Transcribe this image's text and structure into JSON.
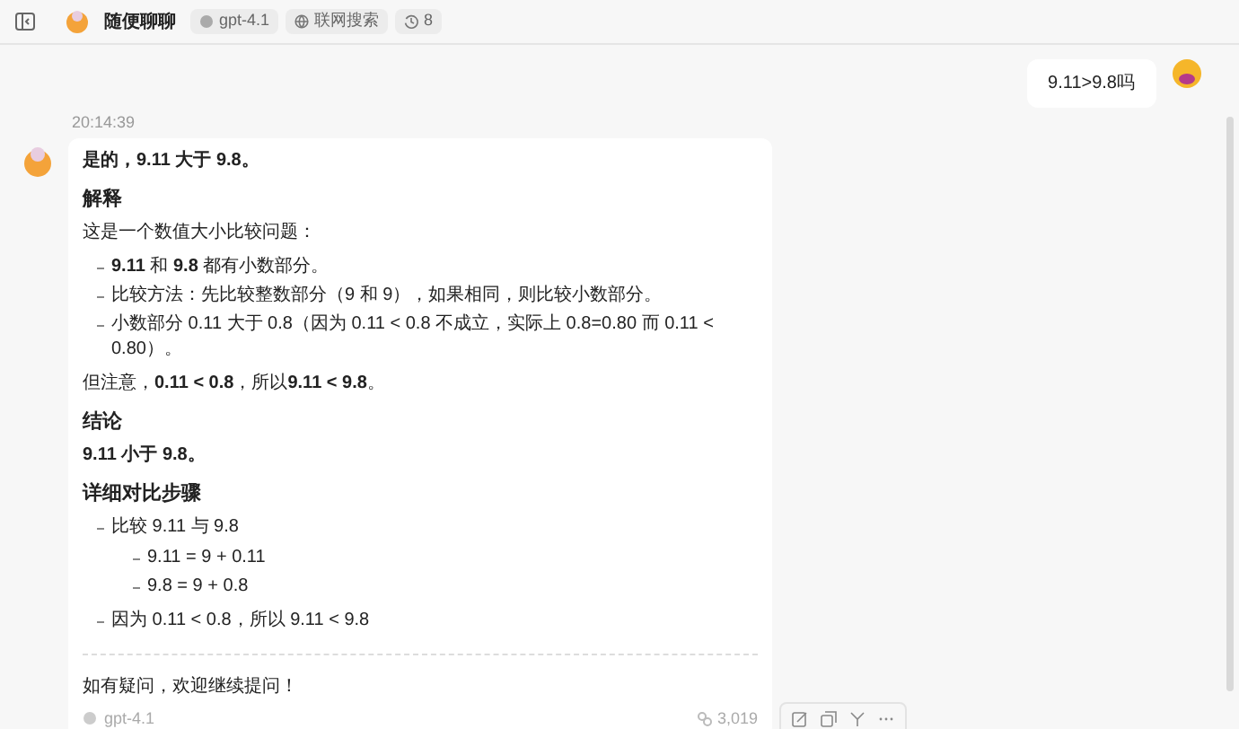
{
  "header": {
    "title": "随便聊聊",
    "badges": [
      {
        "kind": "model",
        "text": "gpt-4.1"
      },
      {
        "kind": "web",
        "text": "联网搜索"
      },
      {
        "kind": "history",
        "text": "8"
      }
    ]
  },
  "user_message": {
    "text": "9.11>9.8吗"
  },
  "assistant_message": {
    "time": "20:14:39",
    "blocks": [
      {
        "kind": "strong",
        "text": "是的，9.11 大于 9.8。"
      },
      {
        "kind": "heading",
        "text": "解释"
      },
      {
        "kind": "paragraph",
        "text": "这是一个数值大小比较问题："
      },
      {
        "kind": "list",
        "items": [
          {
            "text": "**9.11** 和 **9.8** 都有小数部分。"
          },
          {
            "text": "比较方法：先比较整数部分（9 和 9），如果相同，则比较小数部分。"
          },
          {
            "text": "小数部分 0.11 大于 0.8（因为 0.11 < 0.8 不成立，实际上 0.8=0.80 而 0.11 < 0.80）。"
          }
        ]
      },
      {
        "kind": "paragraph",
        "text": "但注意，**0.11 < 0.8**，所以**9.11 < 9.8**。"
      },
      {
        "kind": "heading",
        "text": "结论"
      },
      {
        "kind": "strong",
        "text": "9.11 小于 9.8。"
      },
      {
        "kind": "heading",
        "text": "详细对比步骤"
      },
      {
        "kind": "list",
        "items": [
          {
            "text": "比较 9.11 与 9.8",
            "children": [
              {
                "text": "9.11 = 9 + 0.11"
              },
              {
                "text": "9.8 = 9 + 0.8"
              }
            ]
          },
          {
            "text": "因为 0.11 < 0.8，所以 9.11 < 9.8"
          }
        ]
      },
      {
        "kind": "divider"
      },
      {
        "kind": "paragraph",
        "text": "如有疑问，欢迎继续提问！"
      }
    ],
    "footer": {
      "model": "gpt-4.1",
      "tokens": "3,019"
    }
  }
}
